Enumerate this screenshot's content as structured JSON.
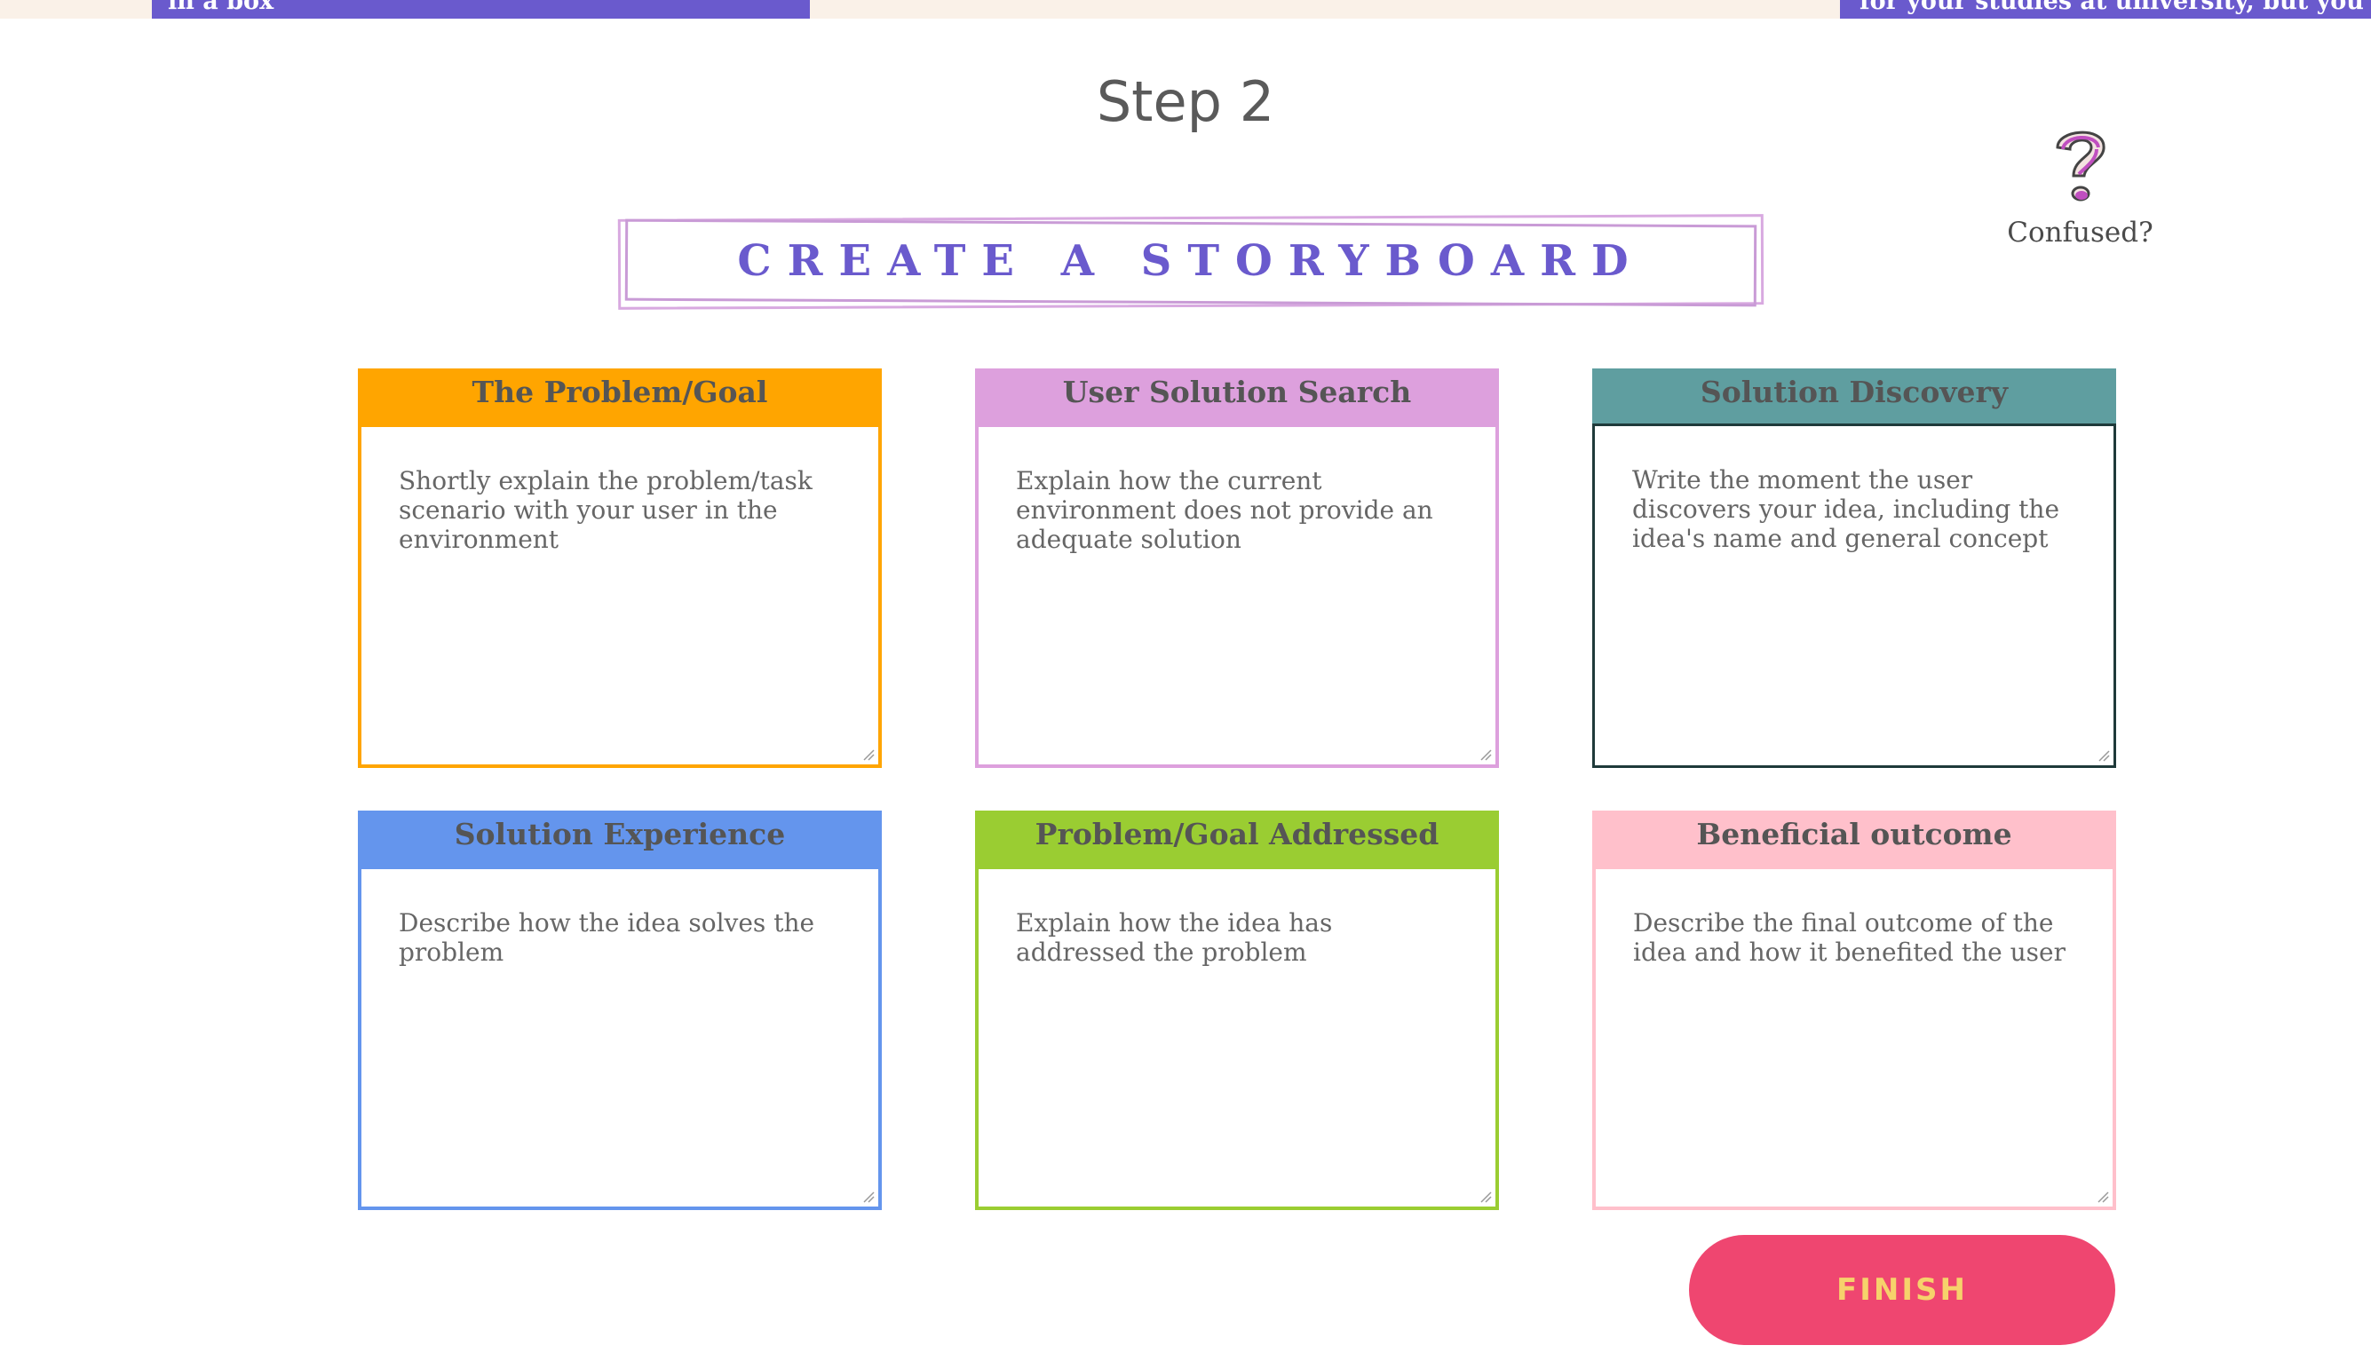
{
  "header": {
    "left_banner_text": "in a box",
    "right_banner_text": "for your studies at university, but you"
  },
  "step": {
    "title": "Step 2"
  },
  "help": {
    "label": "Confused?",
    "icon": "question-mark-icon"
  },
  "banner": {
    "title": "Create a Storyboard"
  },
  "cards": [
    {
      "title": "The Problem/Goal",
      "placeholder": "Shortly explain the problem/task scenario with your user in the environment",
      "color": "#ffa500"
    },
    {
      "title": "User Solution Search",
      "placeholder": "Explain how the current environment does not provide an adequate solution",
      "color": "#dda0dd"
    },
    {
      "title": "Solution Discovery",
      "placeholder": "Write the moment the user discovers your idea, including the idea's name and general concept",
      "color": "#5f9ea0"
    },
    {
      "title": "Solution Experience",
      "placeholder": "Describe how the idea solves the problem",
      "color": "#6495ed"
    },
    {
      "title": "Problem/Goal Addressed",
      "placeholder": "Explain how the idea has addressed the problem",
      "color": "#9acd32"
    },
    {
      "title": "Beneficial outcome",
      "placeholder": "Describe the final outcome of the idea and how it benefited the user",
      "color": "#ffc0cb"
    }
  ],
  "finish": {
    "label": "FINISH"
  }
}
